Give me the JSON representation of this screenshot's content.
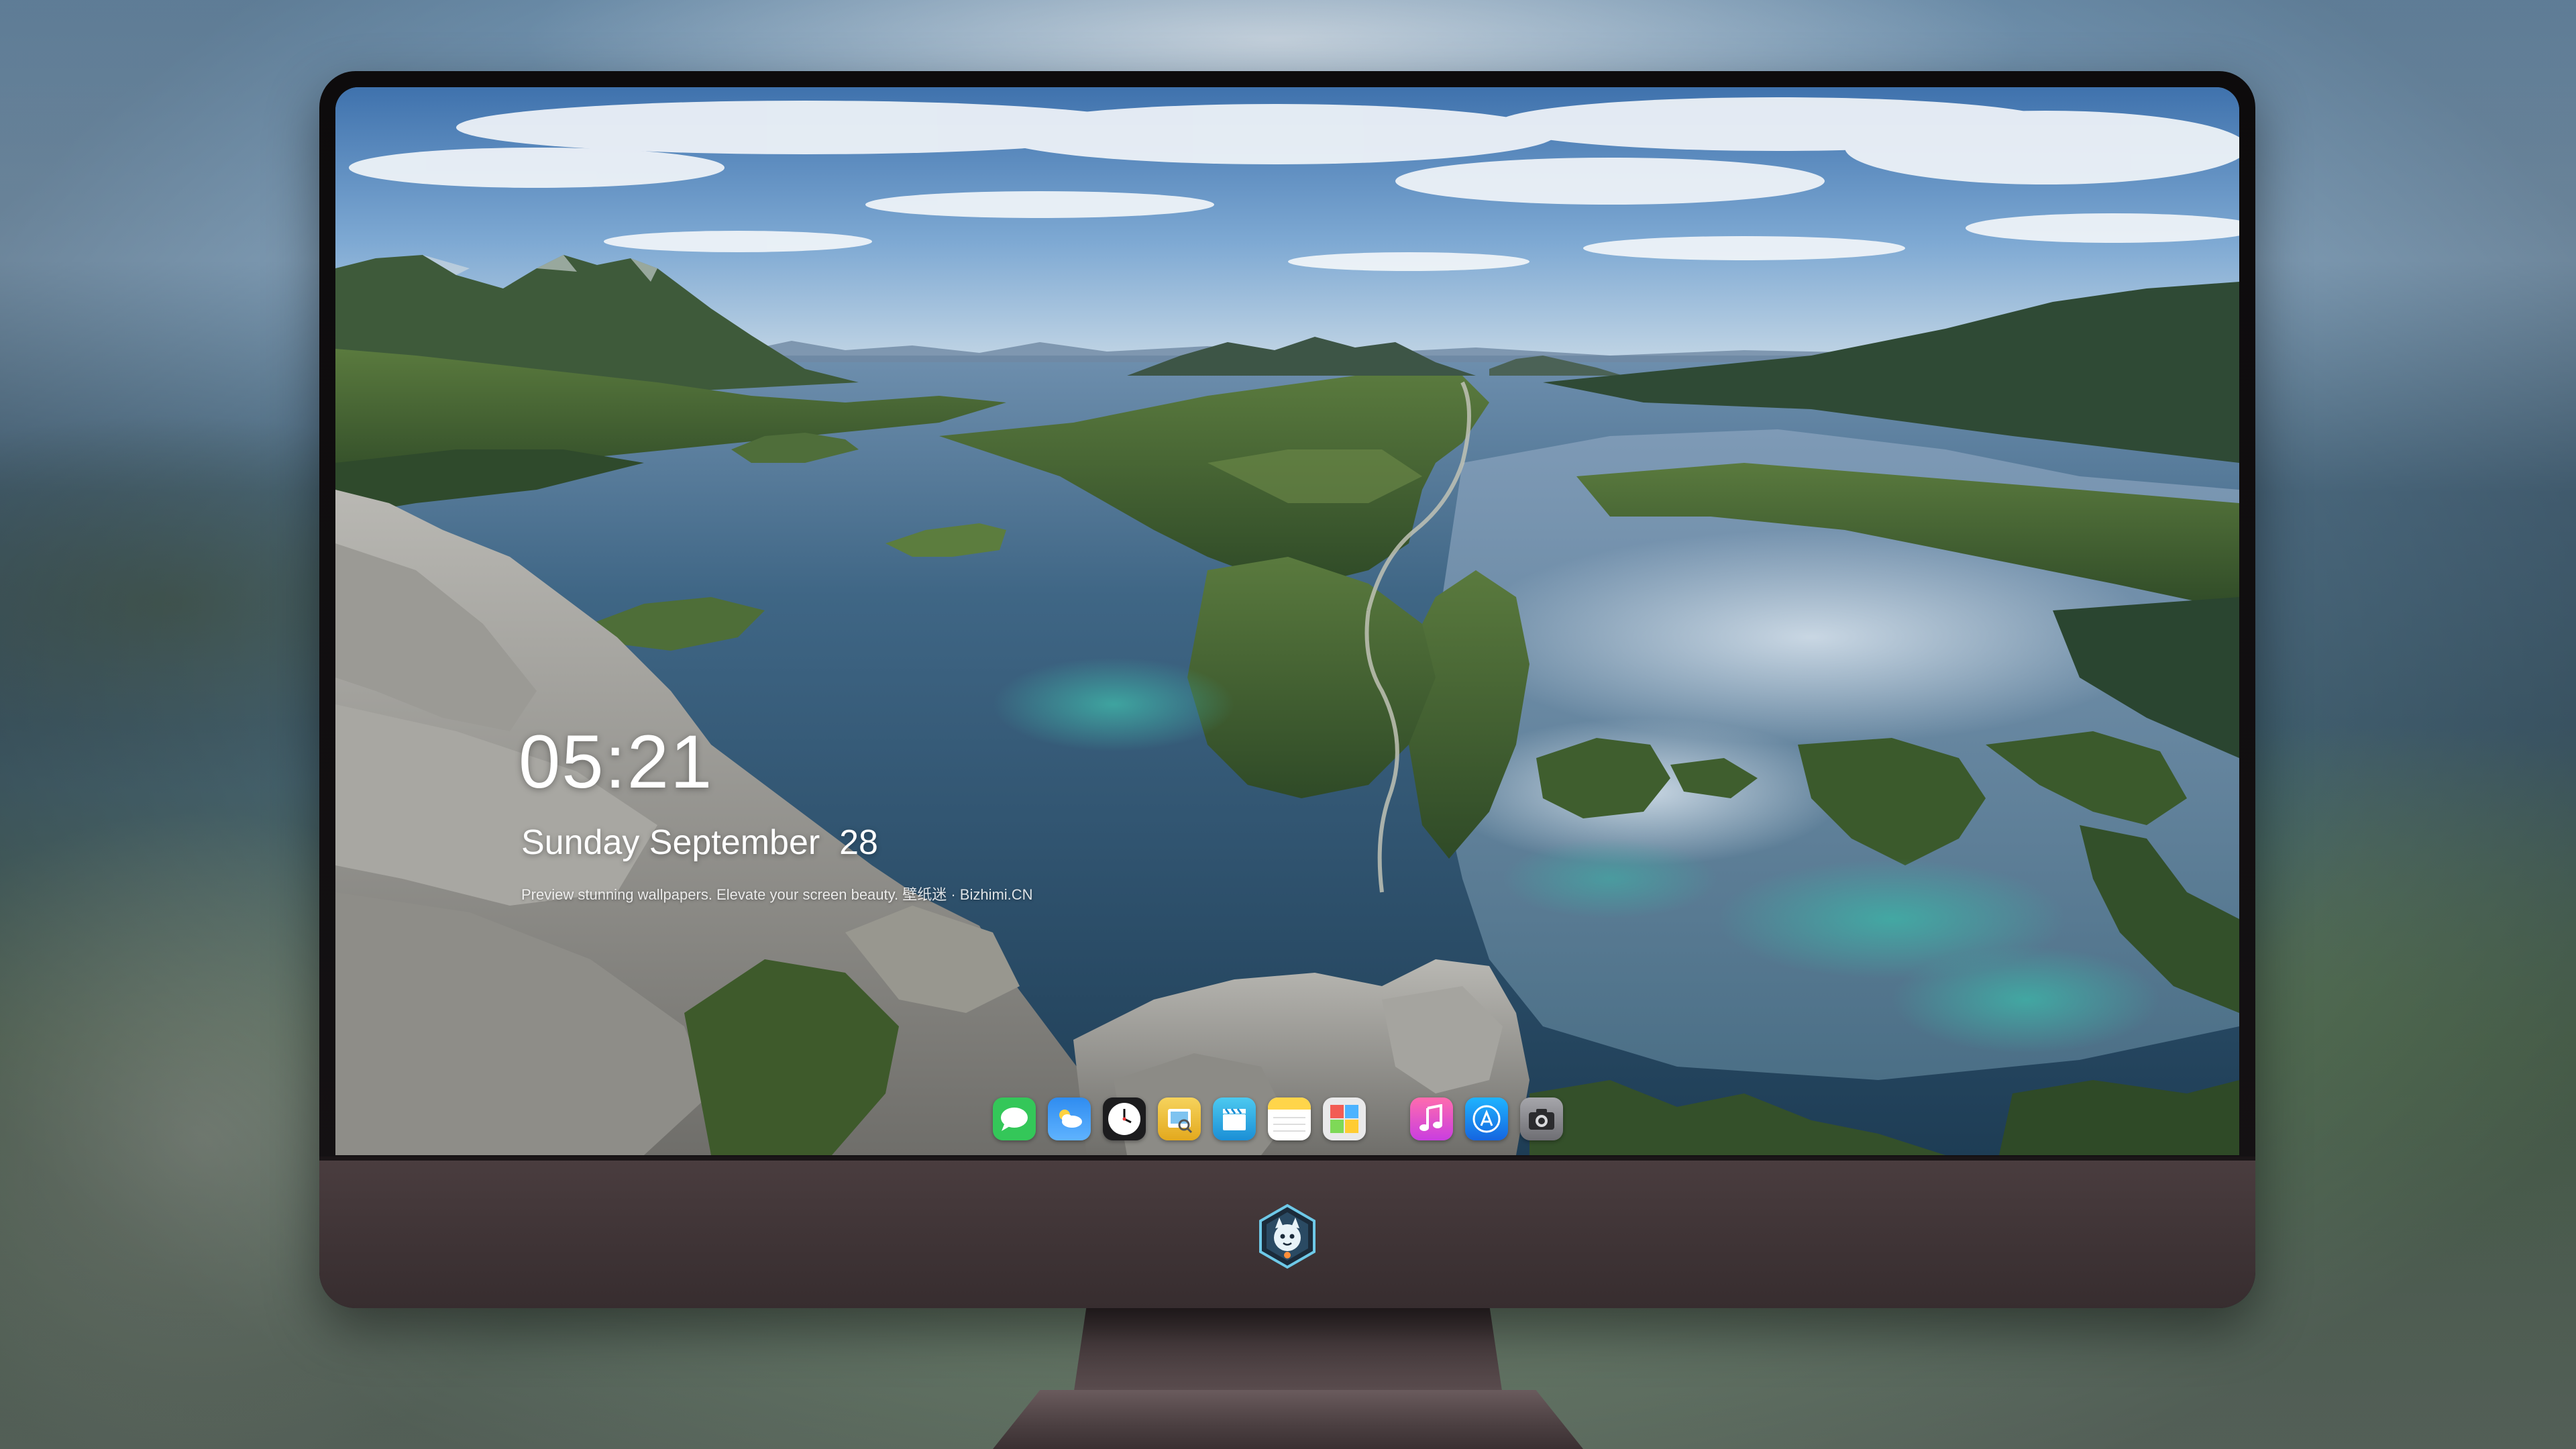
{
  "lock_screen": {
    "time": "05:21",
    "weekday_month": "Sunday September",
    "day": "28",
    "tagline": "Preview stunning wallpapers. Elevate your screen beauty. 壁纸迷 · Bizhimi.CN"
  },
  "dock": {
    "apps": [
      {
        "name": "messages-icon",
        "color": "#34c759"
      },
      {
        "name": "weather-icon",
        "color": "#2f8cf0"
      },
      {
        "name": "clock-icon",
        "color": "#1c1c1e"
      },
      {
        "name": "preview-icon",
        "color": "#f2c230"
      },
      {
        "name": "clips-icon",
        "color": "#2bb3e0"
      },
      {
        "name": "notes-icon",
        "color": "#ffd54a"
      },
      {
        "name": "photo-booth-icon",
        "color": "#e9e9ea"
      },
      {
        "name": "music-icon",
        "color": "#fc3c8a"
      },
      {
        "name": "app-store-icon",
        "color": "#1f8ef1"
      },
      {
        "name": "camera-icon",
        "color": "#8e8e93"
      }
    ]
  },
  "device": {
    "logo": "mascot-logo-icon",
    "bezel_color": "#0d0b0c",
    "chin_color": "#403436"
  }
}
